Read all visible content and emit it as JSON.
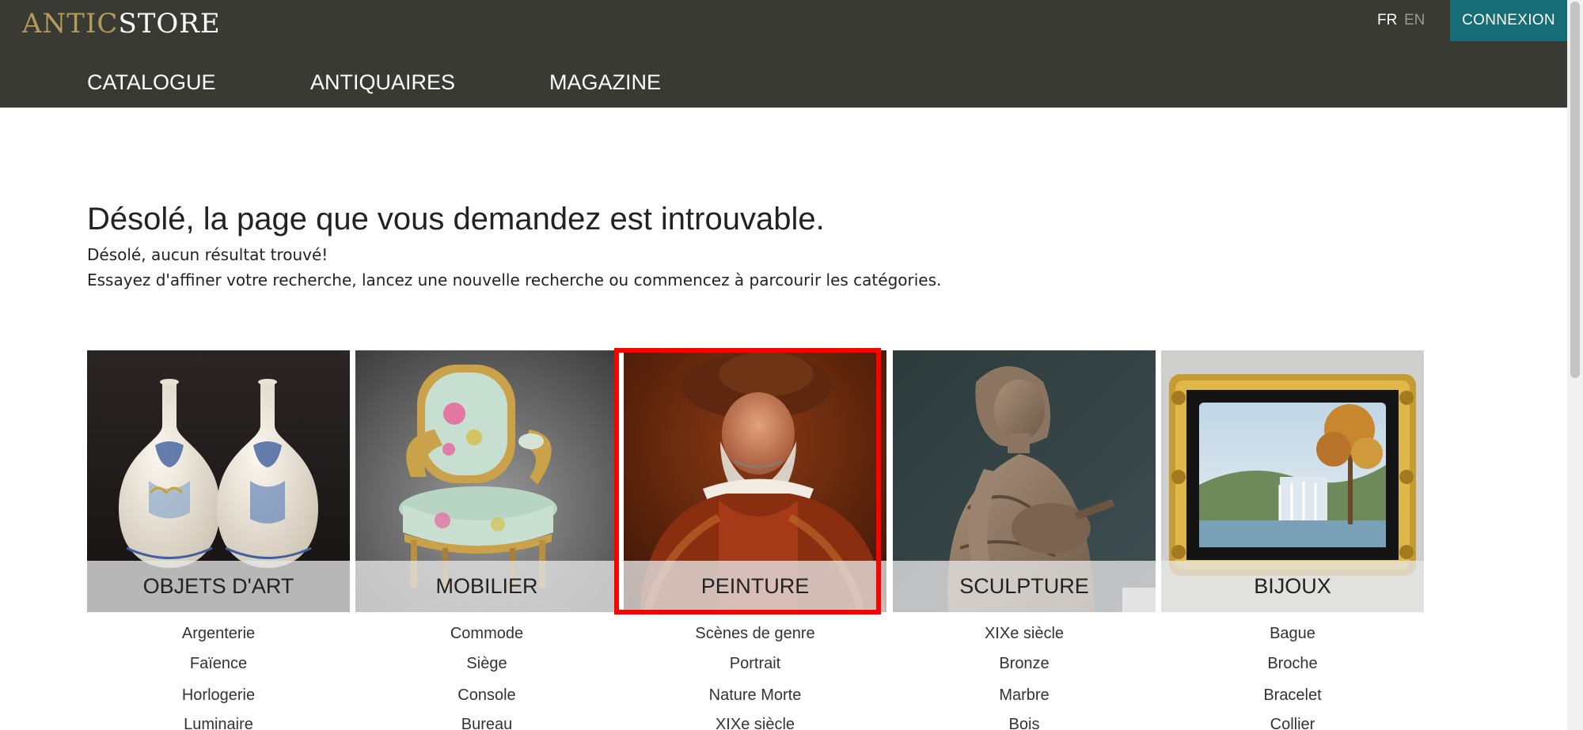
{
  "header": {
    "logo_part1": "ANTIC",
    "logo_part2": "STORE",
    "lang_fr": "FR",
    "lang_en": "EN",
    "login_label": "CONNEXION",
    "nav": [
      "CATALOGUE",
      "ANTIQUAIRES",
      "MAGAZINE"
    ]
  },
  "content": {
    "title": "Désolé, la page que vous demandez est introuvable.",
    "line1": "Désolé, aucun résultat trouvé!",
    "line2": "Essayez d'affiner votre recherche, lancez une nouvelle recherche ou commencez à parcourir les catégories."
  },
  "categories": [
    {
      "label": "OBJETS D'ART",
      "items": [
        "Argenterie",
        "Faïence",
        "Horlogerie",
        "Luminaire"
      ]
    },
    {
      "label": "MOBILIER",
      "items": [
        "Commode",
        "Siège",
        "Console",
        "Bureau"
      ]
    },
    {
      "label": "PEINTURE",
      "items": [
        "Scènes de genre",
        "Portrait",
        "Nature Morte",
        "XIXe siècle"
      ]
    },
    {
      "label": "SCULPTURE",
      "items": [
        "XIXe siècle",
        "Bronze",
        "Marbre",
        "Bois"
      ]
    },
    {
      "label": "BIJOUX",
      "items": [
        "Bague",
        "Broche",
        "Bracelet",
        "Collier"
      ]
    }
  ],
  "colors": {
    "header_bg": "#3a3a35",
    "logo_gold": "#b39c5a",
    "login_bg": "#176d76",
    "highlight": "#ff0000"
  }
}
